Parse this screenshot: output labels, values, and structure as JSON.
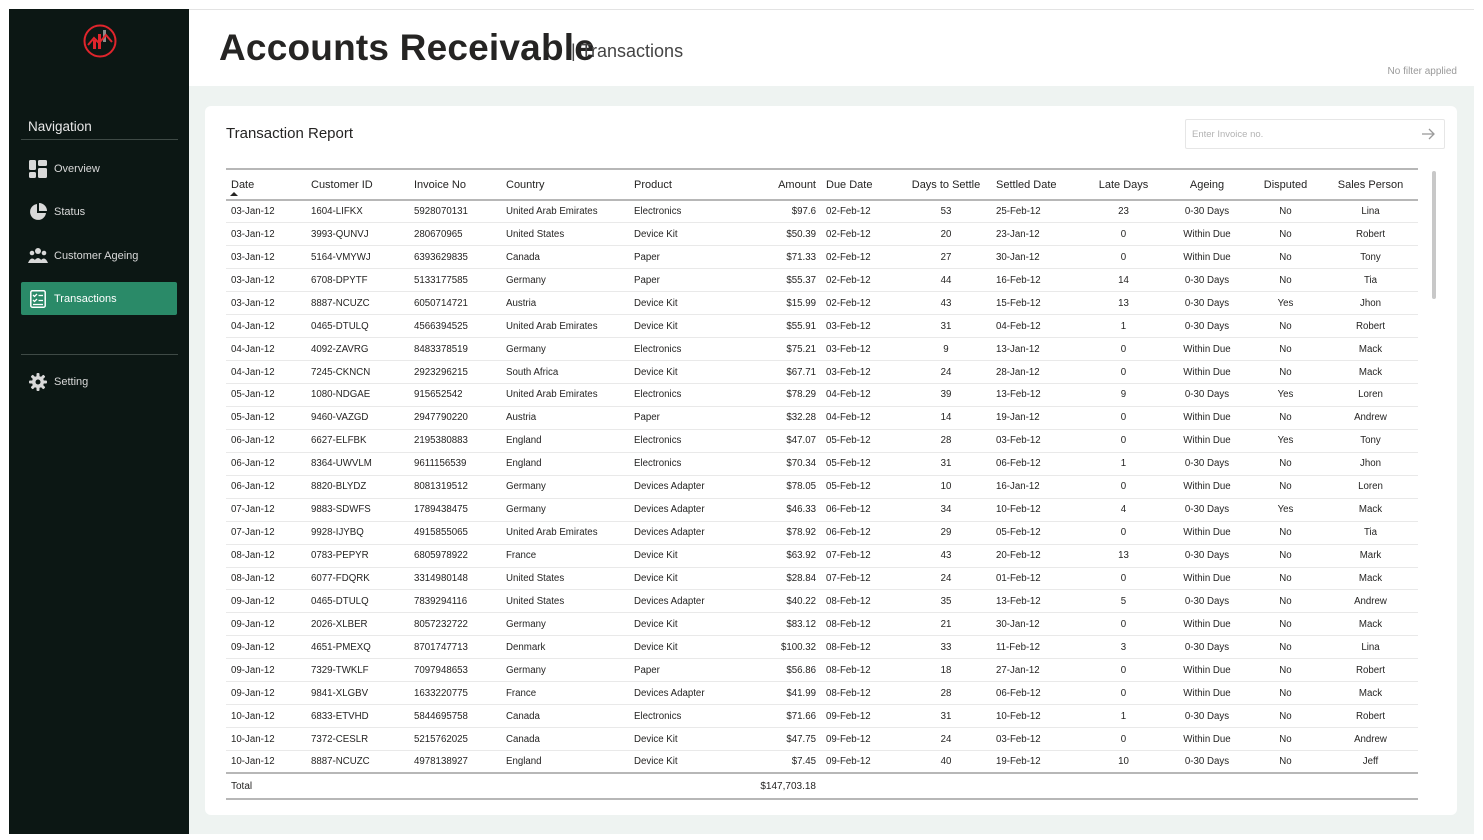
{
  "app": {
    "title": "Accounts Receivable",
    "subtitle": "Transactions",
    "subtitle_separator": "|",
    "filter_note": "No filter applied",
    "accent_color": "#2a8a68",
    "sidebar_color": "#0c1714",
    "logo_color": "#e0252c"
  },
  "sidebar": {
    "logo_icon": "chart-logo-icon",
    "nav_title": "Navigation",
    "items": [
      {
        "label": "Overview",
        "icon": "dashboard-icon",
        "active": false
      },
      {
        "label": "Status",
        "icon": "pie-chart-icon",
        "active": false
      },
      {
        "label": "Customer Ageing",
        "icon": "people-icon",
        "active": false
      },
      {
        "label": "Transactions",
        "icon": "checklist-icon",
        "active": true
      }
    ],
    "setting": {
      "label": "Setting",
      "icon": "gear-icon"
    }
  },
  "report": {
    "title": "Transaction Report",
    "search_placeholder": "Enter Invoice no.",
    "columns": [
      "Date",
      "Customer ID",
      "Invoice No",
      "Country",
      "Product",
      "Amount",
      "Due Date",
      "Days to Settle",
      "Settled Date",
      "Late Days",
      "Ageing",
      "Disputed",
      "Sales Person"
    ],
    "rows": [
      [
        "03-Jan-12",
        "1604-LIFKX",
        "5928070131",
        "United Arab Emirates",
        "Electronics",
        "$97.6",
        "02-Feb-12",
        "53",
        "25-Feb-12",
        "23",
        "0-30 Days",
        "No",
        "Lina"
      ],
      [
        "03-Jan-12",
        "3993-QUNVJ",
        "280670965",
        "United States",
        "Device Kit",
        "$50.39",
        "02-Feb-12",
        "20",
        "23-Jan-12",
        "0",
        "Within Due",
        "No",
        "Robert"
      ],
      [
        "03-Jan-12",
        "5164-VMYWJ",
        "6393629835",
        "Canada",
        "Paper",
        "$71.33",
        "02-Feb-12",
        "27",
        "30-Jan-12",
        "0",
        "Within Due",
        "No",
        "Tony"
      ],
      [
        "03-Jan-12",
        "6708-DPYTF",
        "5133177585",
        "Germany",
        "Paper",
        "$55.37",
        "02-Feb-12",
        "44",
        "16-Feb-12",
        "14",
        "0-30 Days",
        "No",
        "Tia"
      ],
      [
        "03-Jan-12",
        "8887-NCUZC",
        "6050714721",
        "Austria",
        "Device Kit",
        "$15.99",
        "02-Feb-12",
        "43",
        "15-Feb-12",
        "13",
        "0-30 Days",
        "Yes",
        "Jhon"
      ],
      [
        "04-Jan-12",
        "0465-DTULQ",
        "4566394525",
        "United Arab Emirates",
        "Device Kit",
        "$55.91",
        "03-Feb-12",
        "31",
        "04-Feb-12",
        "1",
        "0-30 Days",
        "No",
        "Robert"
      ],
      [
        "04-Jan-12",
        "4092-ZAVRG",
        "8483378519",
        "Germany",
        "Electronics",
        "$75.21",
        "03-Feb-12",
        "9",
        "13-Jan-12",
        "0",
        "Within Due",
        "No",
        "Mack"
      ],
      [
        "04-Jan-12",
        "7245-CKNCN",
        "2923296215",
        "South Africa",
        "Device Kit",
        "$67.71",
        "03-Feb-12",
        "24",
        "28-Jan-12",
        "0",
        "Within Due",
        "No",
        "Mack"
      ],
      [
        "05-Jan-12",
        "1080-NDGAE",
        "915652542",
        "United Arab Emirates",
        "Electronics",
        "$78.29",
        "04-Feb-12",
        "39",
        "13-Feb-12",
        "9",
        "0-30 Days",
        "Yes",
        "Loren"
      ],
      [
        "05-Jan-12",
        "9460-VAZGD",
        "2947790220",
        "Austria",
        "Paper",
        "$32.28",
        "04-Feb-12",
        "14",
        "19-Jan-12",
        "0",
        "Within Due",
        "No",
        "Andrew"
      ],
      [
        "06-Jan-12",
        "6627-ELFBK",
        "2195380883",
        "England",
        "Electronics",
        "$47.07",
        "05-Feb-12",
        "28",
        "03-Feb-12",
        "0",
        "Within Due",
        "Yes",
        "Tony"
      ],
      [
        "06-Jan-12",
        "8364-UWVLM",
        "9611156539",
        "England",
        "Electronics",
        "$70.34",
        "05-Feb-12",
        "31",
        "06-Feb-12",
        "1",
        "0-30 Days",
        "No",
        "Jhon"
      ],
      [
        "06-Jan-12",
        "8820-BLYDZ",
        "8081319512",
        "Germany",
        "Devices Adapter",
        "$78.05",
        "05-Feb-12",
        "10",
        "16-Jan-12",
        "0",
        "Within Due",
        "No",
        "Loren"
      ],
      [
        "07-Jan-12",
        "9883-SDWFS",
        "1789438475",
        "Germany",
        "Devices Adapter",
        "$46.33",
        "06-Feb-12",
        "34",
        "10-Feb-12",
        "4",
        "0-30 Days",
        "Yes",
        "Mack"
      ],
      [
        "07-Jan-12",
        "9928-IJYBQ",
        "4915855065",
        "United Arab Emirates",
        "Devices Adapter",
        "$78.92",
        "06-Feb-12",
        "29",
        "05-Feb-12",
        "0",
        "Within Due",
        "No",
        "Tia"
      ],
      [
        "08-Jan-12",
        "0783-PEPYR",
        "6805978922",
        "France",
        "Device Kit",
        "$63.92",
        "07-Feb-12",
        "43",
        "20-Feb-12",
        "13",
        "0-30 Days",
        "No",
        "Mark"
      ],
      [
        "08-Jan-12",
        "6077-FDQRK",
        "3314980148",
        "United States",
        "Device Kit",
        "$28.84",
        "07-Feb-12",
        "24",
        "01-Feb-12",
        "0",
        "Within Due",
        "No",
        "Mack"
      ],
      [
        "09-Jan-12",
        "0465-DTULQ",
        "7839294116",
        "United States",
        "Devices Adapter",
        "$40.22",
        "08-Feb-12",
        "35",
        "13-Feb-12",
        "5",
        "0-30 Days",
        "No",
        "Andrew"
      ],
      [
        "09-Jan-12",
        "2026-XLBER",
        "8057232722",
        "Germany",
        "Device Kit",
        "$83.12",
        "08-Feb-12",
        "21",
        "30-Jan-12",
        "0",
        "Within Due",
        "No",
        "Mack"
      ],
      [
        "09-Jan-12",
        "4651-PMEXQ",
        "8701747713",
        "Denmark",
        "Device Kit",
        "$100.32",
        "08-Feb-12",
        "33",
        "11-Feb-12",
        "3",
        "0-30 Days",
        "No",
        "Lina"
      ],
      [
        "09-Jan-12",
        "7329-TWKLF",
        "7097948653",
        "Germany",
        "Paper",
        "$56.86",
        "08-Feb-12",
        "18",
        "27-Jan-12",
        "0",
        "Within Due",
        "No",
        "Robert"
      ],
      [
        "09-Jan-12",
        "9841-XLGBV",
        "1633220775",
        "France",
        "Devices Adapter",
        "$41.99",
        "08-Feb-12",
        "28",
        "06-Feb-12",
        "0",
        "Within Due",
        "No",
        "Mack"
      ],
      [
        "10-Jan-12",
        "6833-ETVHD",
        "5844695758",
        "Canada",
        "Electronics",
        "$71.66",
        "09-Feb-12",
        "31",
        "10-Feb-12",
        "1",
        "0-30 Days",
        "No",
        "Robert"
      ],
      [
        "10-Jan-12",
        "7372-CESLR",
        "5215762025",
        "Canada",
        "Device Kit",
        "$47.75",
        "09-Feb-12",
        "24",
        "03-Feb-12",
        "0",
        "Within Due",
        "No",
        "Andrew"
      ],
      [
        "10-Jan-12",
        "8887-NCUZC",
        "4978138927",
        "England",
        "Device Kit",
        "$7.45",
        "09-Feb-12",
        "40",
        "19-Feb-12",
        "10",
        "0-30 Days",
        "No",
        "Jeff"
      ]
    ],
    "total_label": "Total",
    "total_amount": "$147,703.18"
  }
}
